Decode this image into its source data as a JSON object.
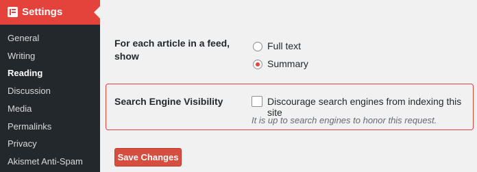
{
  "sidebar": {
    "title": "Settings",
    "items": [
      {
        "label": "General"
      },
      {
        "label": "Writing"
      },
      {
        "label": "Reading"
      },
      {
        "label": "Discussion"
      },
      {
        "label": "Media"
      },
      {
        "label": "Permalinks"
      },
      {
        "label": "Privacy"
      },
      {
        "label": "Akismet Anti-Spam"
      }
    ],
    "active_item": "Reading"
  },
  "feed": {
    "label_line1": "For each article in a feed,",
    "label_line2": "show",
    "options": [
      {
        "label": "Full text",
        "checked": false
      },
      {
        "label": "Summary",
        "checked": true
      }
    ]
  },
  "visibility": {
    "label": "Search Engine Visibility",
    "checkbox_label": "Discourage search engines from indexing this site",
    "checked": false,
    "hint": "It is up to search engines to honor this request."
  },
  "save_button": "Save Changes",
  "colors": {
    "accent": "#e4433b",
    "sidebar_bg": "#23282d",
    "content_bg": "#f1f1f1"
  }
}
